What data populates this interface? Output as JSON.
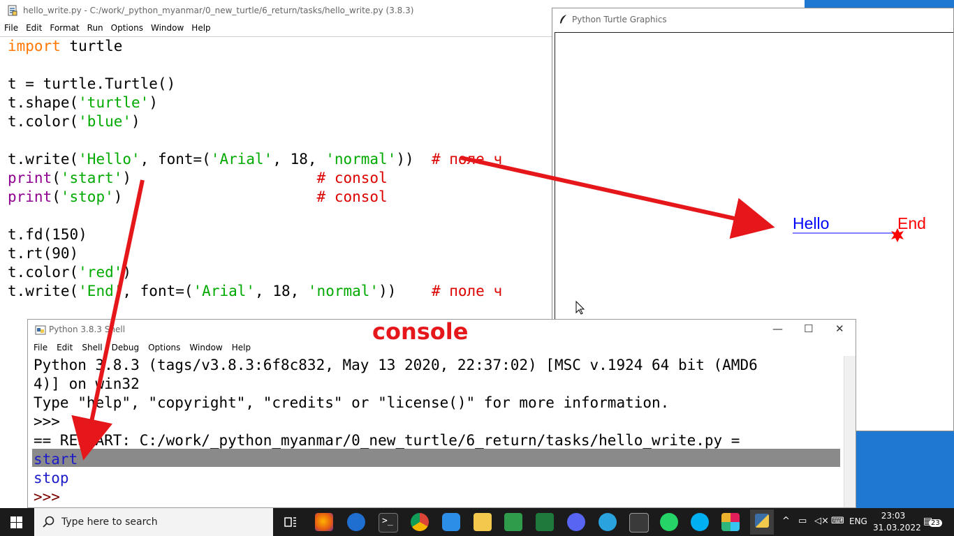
{
  "editor": {
    "title": "hello_write.py - C:/work/_python_myanmar/0_new_turtle/6_return/tasks/hello_write.py (3.8.3)",
    "menu": [
      "File",
      "Edit",
      "Format",
      "Run",
      "Options",
      "Window",
      "Help"
    ]
  },
  "code": {
    "l1_kw": "import",
    "l1_rest": " turtle",
    "l3": "t = turtle.Turtle()",
    "l4_a": "t.shape(",
    "l4_s": "'turtle'",
    "l4_b": ")",
    "l5_a": "t.color(",
    "l5_s": "'blue'",
    "l5_b": ")",
    "l7_a": "t.write(",
    "l7_s1": "'Hello'",
    "l7_b": ", font=(",
    "l7_s2": "'Arial'",
    "l7_c": ", 18, ",
    "l7_s3": "'normal'",
    "l7_d": "))",
    "l7_cm": "# поле ч",
    "l8_bi": "print",
    "l8_a": "(",
    "l8_s": "'start'",
    "l8_b": ")",
    "l8_cm": "# consol",
    "l9_bi": "print",
    "l9_a": "(",
    "l9_s": "'stop'",
    "l9_b": ")",
    "l9_cm": "# consol",
    "l11": "t.fd(150)",
    "l12": "t.rt(90)",
    "l13_a": "t.color(",
    "l13_s": "'red'",
    "l13_b": ")",
    "l14_a": "t.write(",
    "l14_s1": "'End'",
    "l14_b": ", font=(",
    "l14_s2": "'Arial'",
    "l14_c": ", 18, ",
    "l14_s3": "'normal'",
    "l14_d": "))",
    "l14_cm": "# поле ч"
  },
  "turtle": {
    "title": "Python Turtle Graphics",
    "hello_text": "Hello",
    "end_text": "End",
    "hello_color": "#0000ff",
    "end_color": "#ff0000"
  },
  "shell": {
    "title": "Python 3.8.3 Shell",
    "menu": [
      "File",
      "Edit",
      "Shell",
      "Debug",
      "Options",
      "Window",
      "Help"
    ],
    "line1": "Python 3.8.3 (tags/v3.8.3:6f8c832, May 13 2020, 22:37:02) [MSC v.1924 64 bit (AMD6",
    "line2": "4)] on win32",
    "line3": "Type \"help\", \"copyright\", \"credits\" or \"license()\" for more information.",
    "prompt": ">>>",
    "restart": "== RESTART: C:/work/_python_myanmar/0_new_turtle/6_return/tasks/hello_write.py =",
    "out1": "start",
    "out2": "stop",
    "prompt2": ">>>"
  },
  "annotation": {
    "console_label": "console",
    "arrow_color": "#e5171b"
  },
  "taskbar": {
    "search_placeholder": "Type here to search",
    "lang": "ENG",
    "time": "23:03",
    "date": "31.03.2022",
    "notifications": "23"
  },
  "icons": [
    "start-icon",
    "search-icon",
    "task-view-icon",
    "firefox-icon",
    "edge-icon",
    "terminal-icon",
    "chrome-icon",
    "onedrive-icon",
    "file-explorer-icon",
    "sheets-icon",
    "excel-icon",
    "discord-icon",
    "telegram-icon",
    "console-icon",
    "whatsapp-icon",
    "skype-icon",
    "slack-icon",
    "python-icon"
  ]
}
